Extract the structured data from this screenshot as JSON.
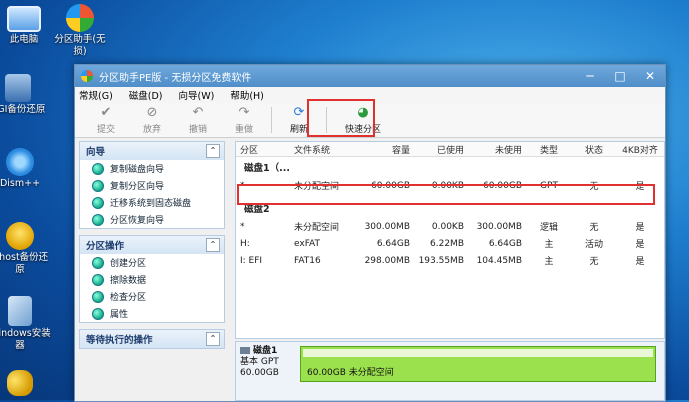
{
  "desktop": {
    "icons": [
      {
        "label": "此电脑",
        "icon": "computer-icon"
      },
      {
        "label": "分区助手(无损)",
        "icon": "partition-assistant-icon"
      },
      {
        "label": "CGI备份还原",
        "icon": "cgi-backup-icon"
      },
      {
        "label": "Dism++",
        "icon": "dism-gear-icon"
      },
      {
        "label": "Ghost备份还原",
        "icon": "ghost-icon"
      },
      {
        "label": "Windows安装器",
        "icon": "windows-installer-icon"
      }
    ]
  },
  "window": {
    "title": "分区助手PE版 - 无损分区免费软件",
    "controls": {
      "minimize": "─",
      "maximize": "□",
      "close": "✕"
    }
  },
  "menu": [
    "常规(G)",
    "磁盘(D)",
    "向导(W)",
    "帮助(H)"
  ],
  "toolbar": {
    "submit": "提交",
    "discard": "放弃",
    "undo": "撤销",
    "redo": "重做",
    "refresh": "刷新",
    "quick_partition": "快速分区"
  },
  "left_panel": {
    "wizard": {
      "title": "向导",
      "items": [
        "复制磁盘向导",
        "复制分区向导",
        "迁移系统到固态磁盘",
        "分区恢复向导"
      ]
    },
    "partition_ops": {
      "title": "分区操作",
      "items": [
        "创建分区",
        "擦除数据",
        "检查分区",
        "属性"
      ]
    },
    "pending_ops": {
      "title": "等待执行的操作"
    },
    "collapse_symbol": "⌃"
  },
  "table": {
    "headers": [
      "分区",
      "文件系统",
      "容量",
      "已使用",
      "未使用",
      "类型",
      "状态",
      "4KB对齐"
    ],
    "disk1": {
      "label": "磁盘1（...",
      "rows": [
        [
          "*",
          "未分配空间",
          "60.00GB",
          "0.00KB",
          "60.00GB",
          "GPT",
          "无",
          "是"
        ]
      ]
    },
    "disk2": {
      "label": "磁盘2",
      "rows": [
        [
          "*",
          "未分配空间",
          "300.00MB",
          "0.00KB",
          "300.00MB",
          "逻辑",
          "无",
          "是"
        ],
        [
          "H:",
          "exFAT",
          "6.64GB",
          "6.22MB",
          "6.64GB",
          "主",
          "活动",
          "是"
        ],
        [
          "I: EFI",
          "FAT16",
          "298.00MB",
          "193.55MB",
          "104.45MB",
          "主",
          "无",
          "是"
        ]
      ]
    }
  },
  "disk_map": {
    "name": "磁盘1",
    "style": "基本 GPT",
    "size": "60.00GB",
    "bar_label": "60.00GB 未分配空间",
    "bar_color": "#9be14d"
  }
}
